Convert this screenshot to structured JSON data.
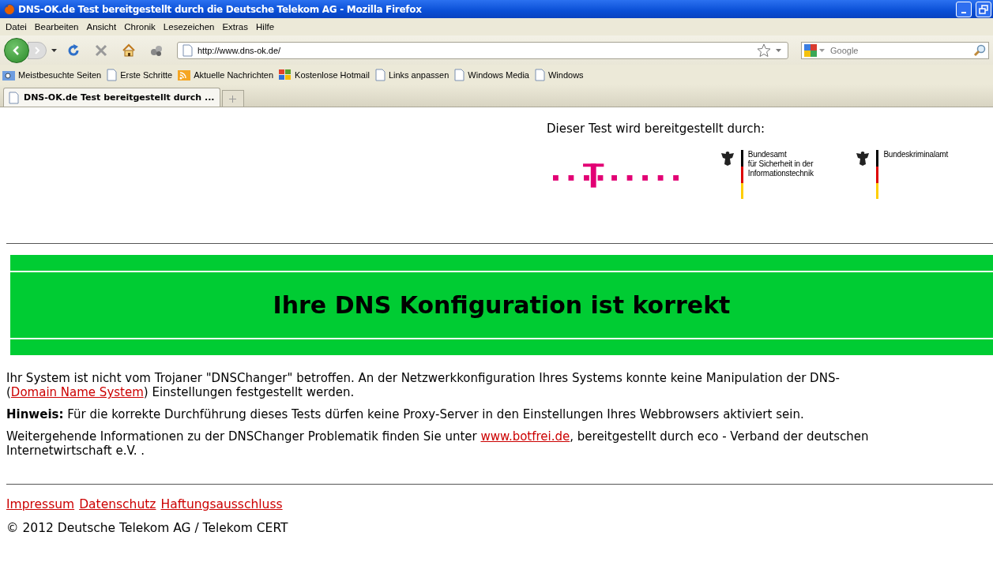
{
  "window": {
    "title": "DNS-OK.de Test bereitgestellt durch die Deutsche Telekom AG - Mozilla Firefox"
  },
  "menu": [
    "Datei",
    "Bearbeiten",
    "Ansicht",
    "Chronik",
    "Lesezeichen",
    "Extras",
    "Hilfe"
  ],
  "address_bar": {
    "value": "http://www.dns-ok.de/"
  },
  "search": {
    "placeholder": "Google"
  },
  "bookmarks": [
    {
      "label": "Meistbesuchte Seiten",
      "kind": "folder"
    },
    {
      "label": "Erste Schritte",
      "kind": "page"
    },
    {
      "label": "Aktuelle Nachrichten",
      "kind": "feed"
    },
    {
      "label": "Kostenlose Hotmail",
      "kind": "windows"
    },
    {
      "label": "Links anpassen",
      "kind": "page"
    },
    {
      "label": "Windows Media",
      "kind": "page"
    },
    {
      "label": "Windows",
      "kind": "page"
    }
  ],
  "tabs": [
    {
      "label": "DNS-OK.de Test bereitgestellt durch ...",
      "selected": true
    }
  ],
  "page": {
    "provider_heading": "Dieser Test wird bereitgestellt durch:",
    "logos": [
      {
        "kind": "telekom"
      },
      {
        "kind": "agency",
        "lines": [
          "Bundesamt",
          "für Sicherheit in der",
          "Informationstechnik"
        ]
      },
      {
        "kind": "agency",
        "lines": [
          "Bundeskriminalamt"
        ]
      }
    ],
    "banner": "Ihre DNS Konfiguration ist korrekt",
    "paragraphs": [
      [
        {
          "kind": "text",
          "text": "Ihr System ist nicht vom Trojaner \"DNSChanger\" betroffen. An der Netzwerkkonfiguration Ihres Systems konnte keine Manipulation der DNS-("
        },
        {
          "kind": "link",
          "text": "Domain Name System"
        },
        {
          "kind": "text",
          "text": ") Einstellungen festgestellt werden."
        }
      ],
      [
        {
          "kind": "text",
          "text": "**Hinweis:** Für die korrekte Durchführung dieses Tests dürfen keine Proxy-Server in den Einstellungen Ihres Webbrowsers aktiviert sein."
        }
      ],
      [
        {
          "kind": "text",
          "text": "Weitergehende Informationen zu der DNSChanger Problematik finden Sie unter "
        },
        {
          "kind": "link",
          "text": "www.botfrei.de"
        },
        {
          "kind": "text",
          "text": ", bereitgestellt durch eco - Verband der deutschen Internetwirtschaft e.V. ."
        }
      ]
    ],
    "footer_links": [
      "Impressum",
      "Datenschutz",
      "Haftungsausschluss"
    ],
    "copyright": "© 2012 Deutsche Telekom AG / Telekom CERT"
  }
}
